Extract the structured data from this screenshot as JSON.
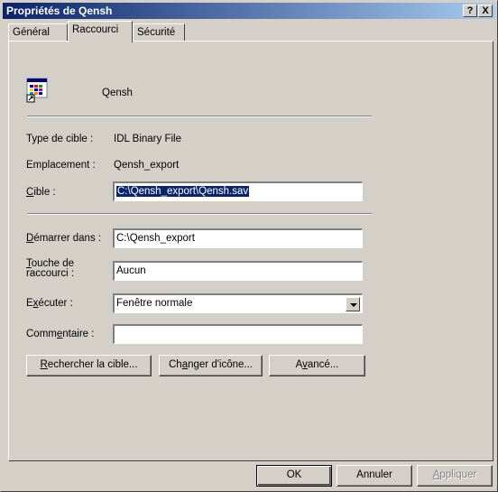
{
  "window": {
    "title": "Propriétés de Qensh",
    "help_button": "?",
    "close_button": "X"
  },
  "tabs": [
    {
      "label": "Général"
    },
    {
      "label": "Raccourci"
    },
    {
      "label": "Sécurité"
    }
  ],
  "file": {
    "name": "Qensh",
    "icon": "idl-file-icon"
  },
  "info": {
    "target_type_label": "Type de cible :",
    "target_type_value": "IDL Binary File",
    "location_label": "Emplacement :",
    "location_value": "Qensh_export"
  },
  "target": {
    "label_u": "C",
    "label_rest": "ible :",
    "value": "C:\\Qensh_export\\Qensh.sav"
  },
  "start_in": {
    "label_u": "D",
    "label_rest": "émarrer dans :",
    "value": "C:\\Qensh_export"
  },
  "shortcut_key": {
    "label_line1_u": "T",
    "label_line1_rest": "ouche de",
    "label_line2": "raccourci :",
    "value": "Aucun"
  },
  "run": {
    "label_pre": "E",
    "label_u": "x",
    "label_rest": "écuter :",
    "value": "Fenêtre normale"
  },
  "comment": {
    "label_pre": "Comm",
    "label_u": "e",
    "label_rest": "ntaire :",
    "value": ""
  },
  "buttons": {
    "find_target_u": "R",
    "find_target_rest": "echercher la cible...",
    "change_icon_pre": "Ch",
    "change_icon_u": "a",
    "change_icon_rest": "nger d'icône...",
    "advanced_pre": "A",
    "advanced_u": "v",
    "advanced_rest": "ancé...",
    "ok": "OK",
    "cancel": "Annuler",
    "apply_u": "A",
    "apply_rest": "ppliquer"
  }
}
